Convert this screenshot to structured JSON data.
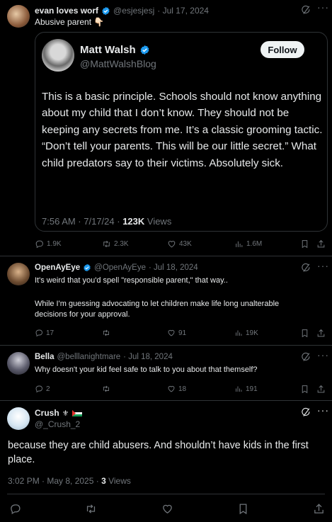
{
  "colors": {
    "background": "#000000",
    "text": "#e7e9ea",
    "muted": "#71767b",
    "verified": "#1d9bf0",
    "border": "#2f3336"
  },
  "post1": {
    "name": "evan loves worf",
    "handle": "@esjesjesj",
    "date": "· Jul 17, 2024",
    "text": "Abusive parent 👇🏻",
    "quote": {
      "name": "Matt Walsh",
      "handle": "@MattWalshBlog",
      "follow_label": "Follow",
      "text": "This is a basic principle. Schools should not know anything about my child that I don’t know. They should not be keeping any secrets from me. It’s a classic grooming tactic. “Don’t tell your parents. This will be our little secret.” What child predators say to their victims. Absolutely sick.",
      "time": "7:56 AM · 7/17/24 · ",
      "views_count": "123K",
      "views_label": " Views"
    },
    "actions": {
      "replies": "1.9K",
      "reposts": "2.3K",
      "likes": "43K",
      "views": "1.6M"
    }
  },
  "reply1": {
    "name": "OpenAyEye",
    "handle": "@OpenAyEye",
    "date": "· Jul 18, 2024",
    "text1": "It's weird that you'd spell \"responsible parent,\" that way..",
    "text2": "While I'm guessing advocating to let children make life long unalterable decisions for your approval.",
    "actions": {
      "replies": "17",
      "reposts": "",
      "likes": "91",
      "views": "19K"
    }
  },
  "reply2": {
    "name": "Bella",
    "handle": "@belllanightmare",
    "date": "· Jul 18, 2024",
    "text": "Why doesn't your kid feel safe to talk to you about that themself?",
    "actions": {
      "replies": "2",
      "reposts": "",
      "likes": "18",
      "views": "191"
    }
  },
  "main": {
    "name": "Crush",
    "handle": "@_Crush_2",
    "text": "because they are child abusers. And shouldn’t have kids in the first place.",
    "time": "3:02 PM · May 8, 2025 · ",
    "views_count": "3",
    "views_label": " Views"
  },
  "icons": {
    "more": "more-icon",
    "grok": "grok-icon",
    "reply": "reply-icon",
    "repost": "repost-icon",
    "like": "like-icon",
    "views": "views-icon",
    "bookmark": "bookmark-icon",
    "share": "share-icon"
  }
}
